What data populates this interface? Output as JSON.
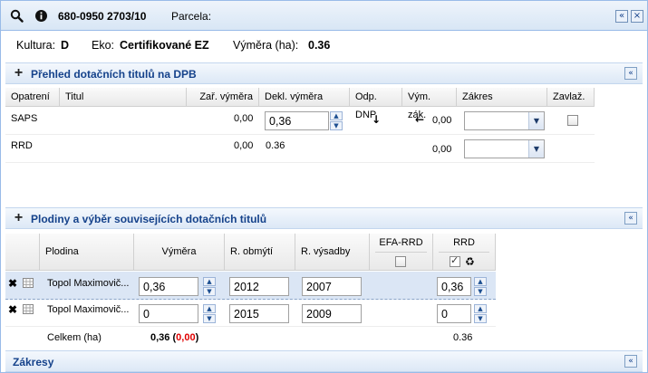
{
  "header": {
    "parcel_id": "680-0950 2703/10",
    "parcela_label": "Parcela:",
    "collapse_glyph": "«",
    "close_glyph": "×"
  },
  "info": {
    "kultura_label": "Kultura:",
    "kultura_value": "D",
    "eko_label": "Eko:",
    "eko_value": "Certifikované EZ",
    "vymera_label": "Výměra (ha):",
    "vymera_value": "0.36"
  },
  "section1": {
    "title": "Přehled dotačních titulů na DPB",
    "columns": [
      "Opatrení",
      "Titul",
      "Zař. výměra",
      "Dekl. výměra",
      "Odp. DNP",
      "Vým. zák.",
      "Zákres",
      "Zavlaž."
    ],
    "rows": [
      {
        "opatreni": "SAPS",
        "titul": "",
        "zar_vymera": "0,00",
        "dekl_vymera": "0,36",
        "odp_dnp": "↓",
        "vym_zak_arrow": "←",
        "vym_zak": "0,00",
        "zakres": ""
      },
      {
        "opatreni": "RRD",
        "titul": "",
        "zar_vymera": "0,00",
        "dekl_vymera": "0.36",
        "odp_dnp": "",
        "vym_zak_arrow": "",
        "vym_zak": "0,00",
        "zakres": ""
      }
    ]
  },
  "section2": {
    "title": "Plodiny a výběr souvisejících dotačních titulů",
    "columns": {
      "plodina": "Plodina",
      "vymera": "Výměra",
      "r_obmyti": "R. obmýtí",
      "r_vysadby": "R. výsadby",
      "efa_rrd": "EFA-RRD",
      "rrd": "RRD"
    },
    "rows": [
      {
        "plodina": "Topol Maximovič...",
        "vymera": "0,36",
        "r_obmyti": "2012",
        "r_vysadby": "2007",
        "rrd": "0,36"
      },
      {
        "plodina": "Topol Maximovič...",
        "vymera": "0",
        "r_obmyti": "2015",
        "r_vysadby": "2009",
        "rrd": "0"
      }
    ],
    "total": {
      "label": "Celkem (ha)",
      "vymera": "0,36",
      "remaining_open": "(",
      "remaining": "0,00",
      "remaining_close": ")",
      "rrd": "0.36"
    },
    "colors": {
      "remaining": "#e00000"
    }
  },
  "section3": {
    "title": "Zákresy"
  }
}
